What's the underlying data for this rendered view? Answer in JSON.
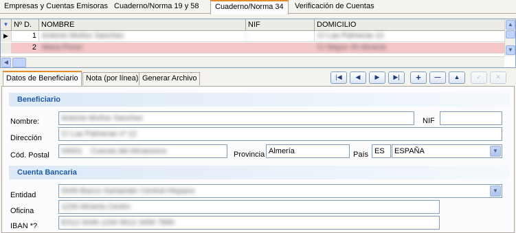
{
  "top_tabs": [
    {
      "label": "Empresas y Cuentas Emisoras",
      "active": false
    },
    {
      "label": "Cuaderno/Norma 19 y 58",
      "active": false
    },
    {
      "label": "Cuaderno/Norma 34",
      "active": true
    },
    {
      "label": "Verificación de Cuentas",
      "active": false
    }
  ],
  "grid": {
    "corner_icon": "triangle-down-icon",
    "columns": [
      "Nº D.",
      "NOMBRE",
      "NIF",
      "DOMICILIO"
    ],
    "rows": [
      {
        "num": "1",
        "nombre": "Antonio Muñoz Sanchez",
        "nif": "",
        "domicilio": "C/ Las Palmeras 12"
      },
      {
        "num": "2",
        "nombre": "Maria Perez",
        "nif": "",
        "domicilio": "C/ Mayor 45 Almeria"
      }
    ]
  },
  "sub_tabs": [
    {
      "label": "Datos de Beneficiario",
      "active": true
    },
    {
      "label": "Nota (por línea)",
      "active": false
    },
    {
      "label": "Generar Archivo",
      "active": false
    }
  ],
  "nav_buttons": [
    {
      "icon": "first-record-icon",
      "glyph": "|◀"
    },
    {
      "icon": "prev-record-icon",
      "glyph": "◀"
    },
    {
      "icon": "next-record-icon",
      "glyph": "▶"
    },
    {
      "icon": "last-record-icon",
      "glyph": "▶|"
    },
    {
      "icon": "add-icon",
      "glyph": "+"
    },
    {
      "icon": "delete-icon",
      "glyph": "—"
    },
    {
      "icon": "up-icon",
      "glyph": "▲"
    },
    {
      "icon": "confirm-icon",
      "glyph": "✓"
    },
    {
      "icon": "cancel-icon",
      "glyph": "✕"
    }
  ],
  "beneficiario": {
    "title": "Beneficiario",
    "nombre_label": "Nombre:",
    "nombre_value": "Antonio Muñoz Sanchez",
    "nif_label": "NIF",
    "nif_value": "",
    "direccion_label": "Dirección",
    "direccion_value": "C/ Las Palmeras nº 12",
    "cp_label": "Cód. Postal",
    "cp_value": "04001",
    "poblacion_value": "Cuevas del Almanzora",
    "provincia_label": "Provincia",
    "provincia_value": "Almería",
    "pais_label": "País",
    "pais_code": "ES",
    "pais_value": "ESPAÑA"
  },
  "cuenta": {
    "title": "Cuenta Bancaria",
    "entidad_label": "Entidad",
    "entidad_value": "0049 Banco Santander Central Hispano",
    "oficina_label": "Oficina",
    "oficina_value": "1234 Almeria Centro",
    "iban_label": "IBAN *?",
    "iban_value": "ES12 0049 1234 5612 3456 7890"
  }
}
